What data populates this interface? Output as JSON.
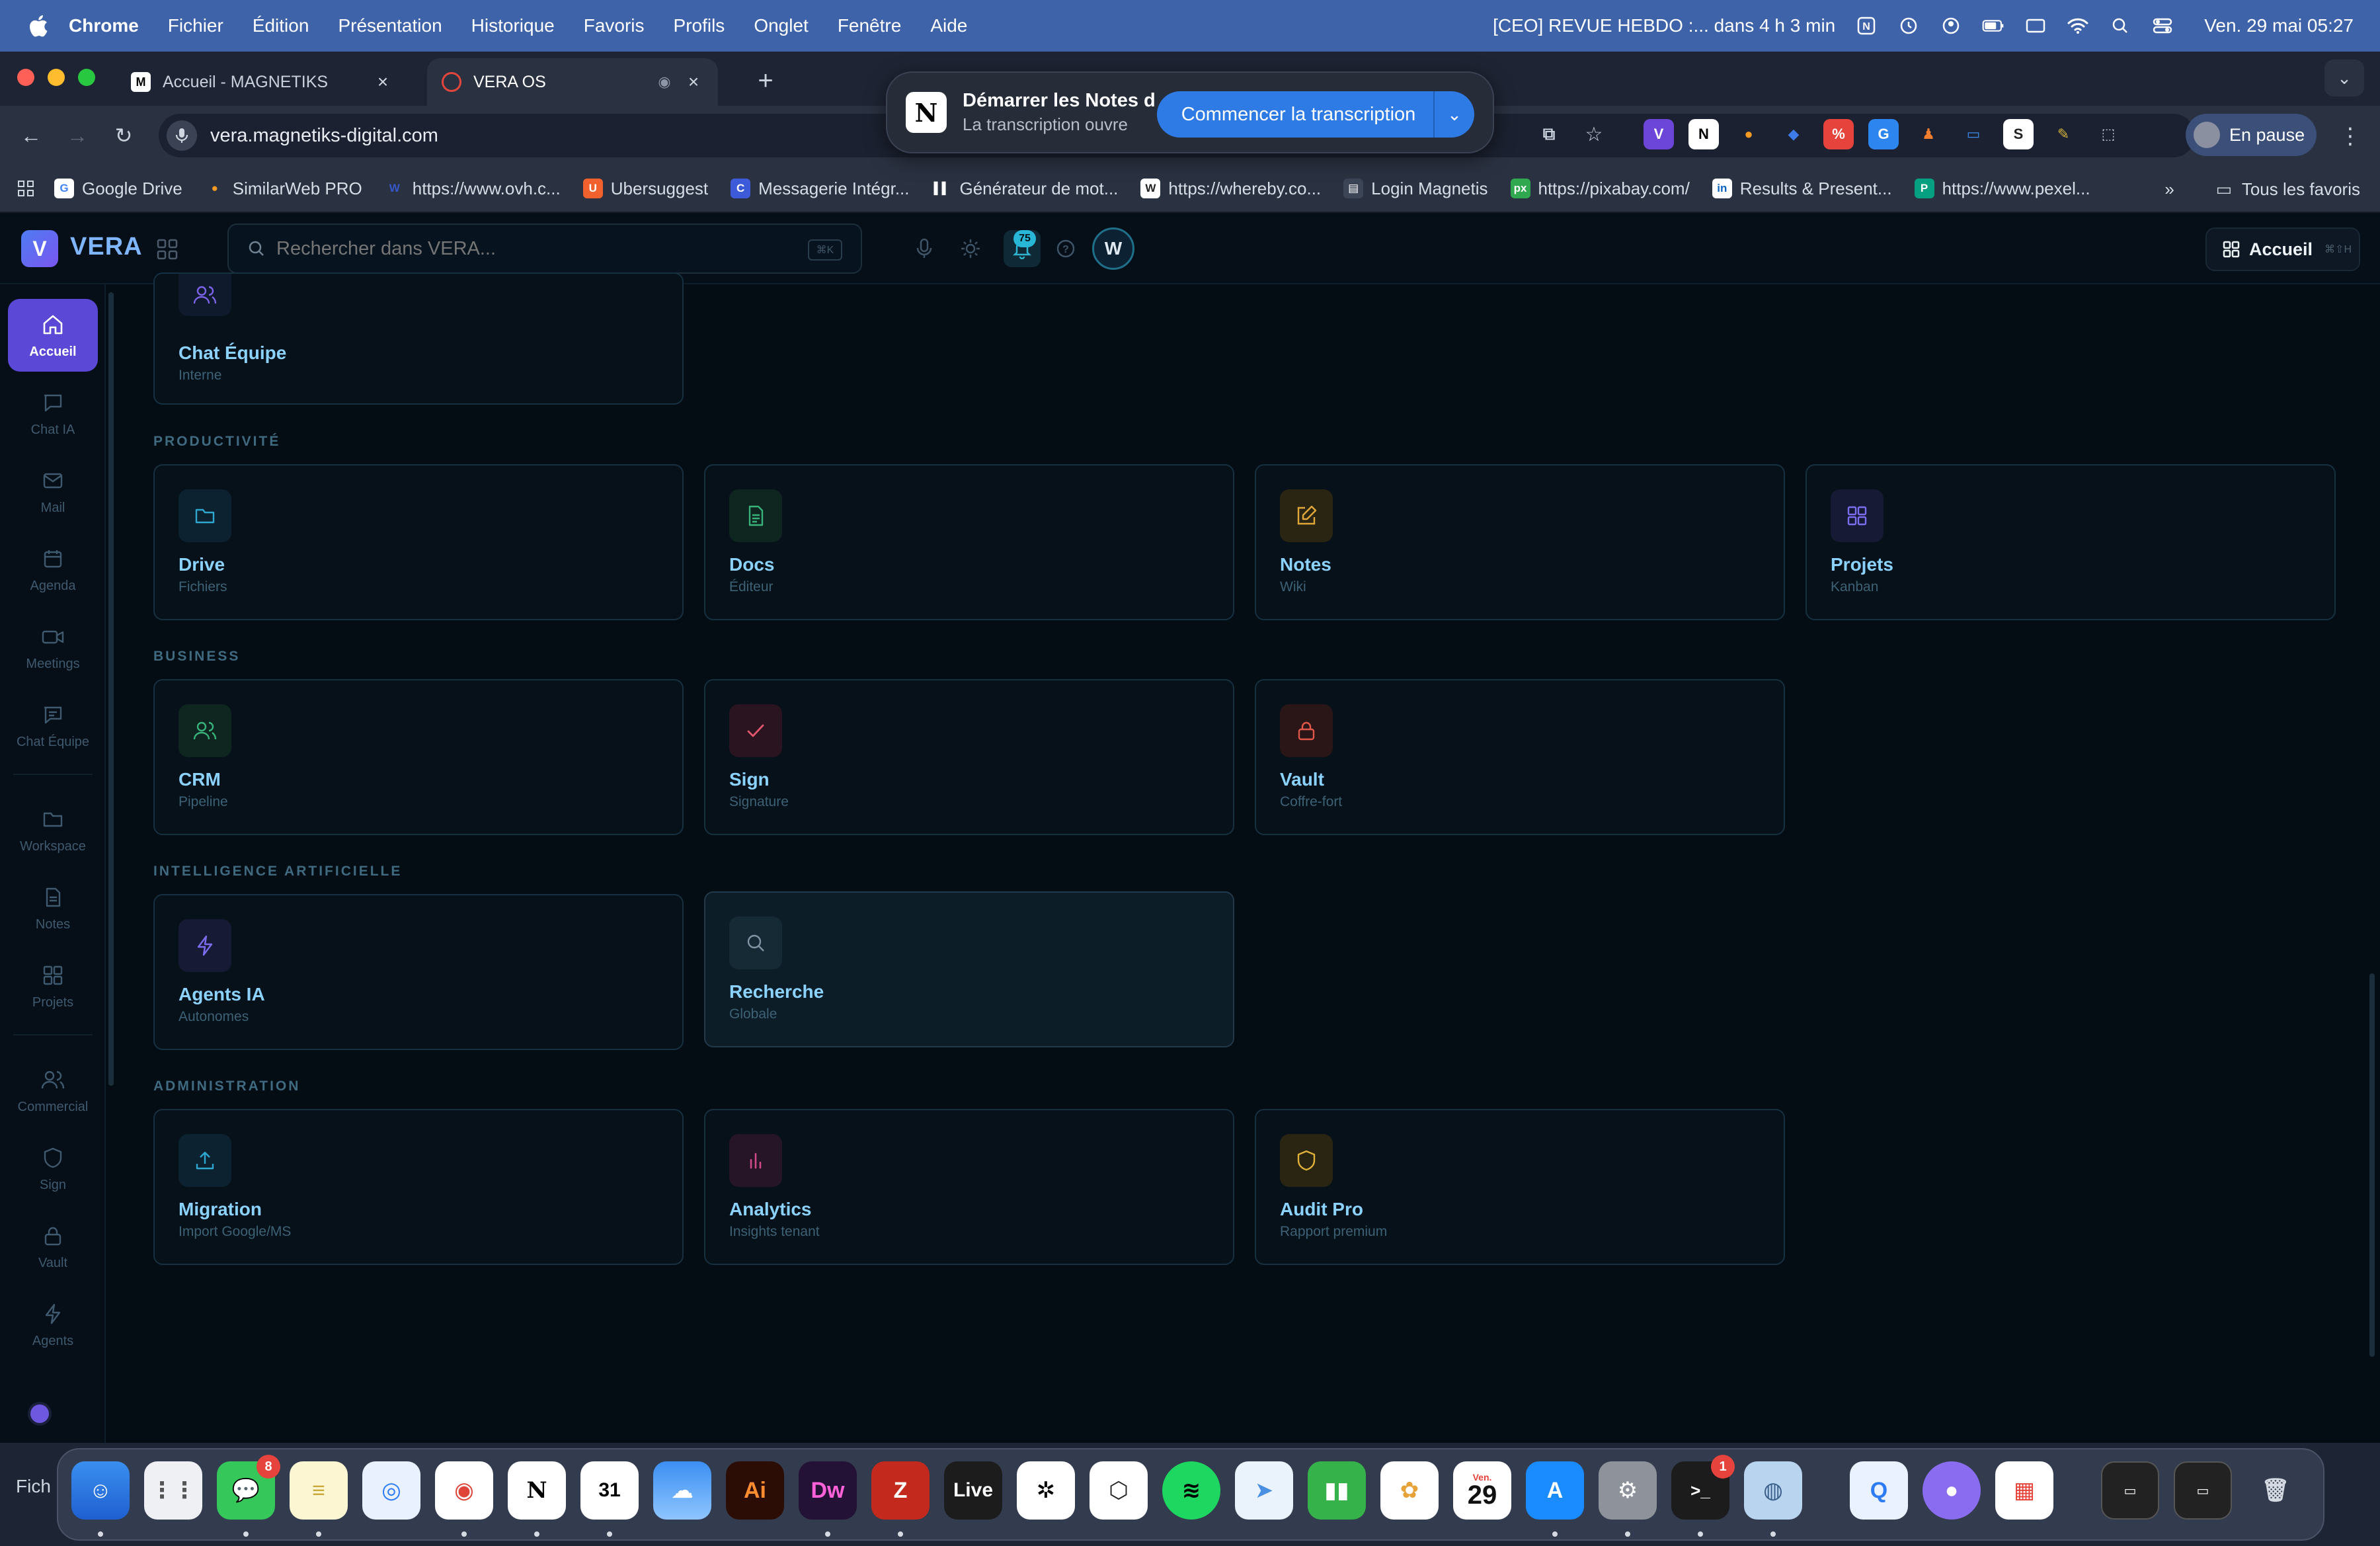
{
  "menubar": {
    "app": "Chrome",
    "items": [
      "Fichier",
      "Édition",
      "Présentation",
      "Historique",
      "Favoris",
      "Profils",
      "Onglet",
      "Fenêtre",
      "Aide"
    ],
    "event": "[CEO] REVUE HEBDO :... dans 4 h 3 min",
    "clock": "Ven. 29 mai  05:27"
  },
  "tabs": [
    {
      "title": "Accueil - MAGNETIKS",
      "active": false
    },
    {
      "title": "VERA OS",
      "active": true
    }
  ],
  "address": {
    "url": "vera.magnetiks-digital.com"
  },
  "profile": {
    "label": "En pause"
  },
  "notion_popup": {
    "title": "Démarrer les Notes d",
    "subtitle": "La transcription ouvre",
    "button": "Commencer la transcription"
  },
  "bookmarks": [
    "Google Drive",
    "SimilarWeb PRO",
    "https://www.ovh.c...",
    "Ubersuggest",
    "Messagerie Intégr...",
    "Générateur de mot...",
    "https://whereby.co...",
    "Login Magnetis",
    "https://pixabay.com/",
    "Results & Present...",
    "https://www.pexel..."
  ],
  "bookmarks_more": "»",
  "bookmarks_all": "Tous les favoris",
  "vera": {
    "brand": "VERA",
    "search_placeholder": "Rechercher dans VERA...",
    "search_kbd": "⌘K",
    "notification_count": "75",
    "user_initial": "W",
    "home_button": "Accueil",
    "home_kbd": "⌘⇧H",
    "sidebar": [
      {
        "label": "Accueil",
        "icon": "home-icon",
        "active": true
      },
      {
        "label": "Chat IA",
        "icon": "chat-icon"
      },
      {
        "label": "Mail",
        "icon": "mail-icon"
      },
      {
        "label": "Agenda",
        "icon": "calendar-icon"
      },
      {
        "label": "Meetings",
        "icon": "video-icon"
      },
      {
        "label": "Chat Équipe",
        "icon": "team-chat-icon"
      },
      {
        "label": "Workspace",
        "icon": "folder-icon"
      },
      {
        "label": "Notes",
        "icon": "note-icon"
      },
      {
        "label": "Projets",
        "icon": "grid-icon"
      },
      {
        "label": "Commercial",
        "icon": "users-icon"
      },
      {
        "label": "Sign",
        "icon": "shield-icon"
      },
      {
        "label": "Vault",
        "icon": "lock-icon"
      },
      {
        "label": "Agents",
        "icon": "bolt-icon"
      }
    ],
    "top_card": {
      "name": "Chat Équipe",
      "sub": "Interne"
    },
    "sections": [
      {
        "title": "PRODUCTIVITÉ",
        "cards": [
          {
            "name": "Drive",
            "sub": "Fichiers"
          },
          {
            "name": "Docs",
            "sub": "Éditeur"
          },
          {
            "name": "Notes",
            "sub": "Wiki"
          },
          {
            "name": "Projets",
            "sub": "Kanban"
          }
        ]
      },
      {
        "title": "BUSINESS",
        "cards": [
          {
            "name": "CRM",
            "sub": "Pipeline"
          },
          {
            "name": "Sign",
            "sub": "Signature"
          },
          {
            "name": "Vault",
            "sub": "Coffre-fort"
          }
        ]
      },
      {
        "title": "INTELLIGENCE ARTIFICIELLE",
        "cards": [
          {
            "name": "Agents IA",
            "sub": "Autonomes"
          },
          {
            "name": "Recherche",
            "sub": "Globale"
          }
        ]
      },
      {
        "title": "ADMINISTRATION",
        "cards": [
          {
            "name": "Migration",
            "sub": "Import Google/MS"
          },
          {
            "name": "Analytics",
            "sub": "Insights tenant"
          },
          {
            "name": "Audit Pro",
            "sub": "Rapport premium"
          }
        ]
      }
    ]
  },
  "dock": {
    "left_label": "Fich",
    "messages_badge": "8",
    "terminal_badge": "1",
    "calendar_day": "29",
    "calendar_month": "Ven."
  }
}
